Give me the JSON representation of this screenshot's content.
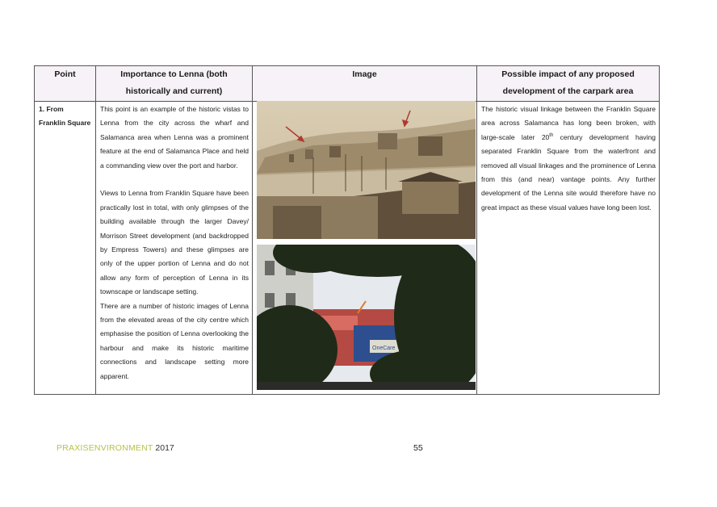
{
  "table": {
    "headers": {
      "point": "Point",
      "importance_line1": "Importance to Lenna (both",
      "importance_line2": "historically and current)",
      "image": "Image",
      "impact_line1": "Possible impact of any proposed",
      "impact_line2": "development of the carpark area"
    },
    "row": {
      "point_line1": "1. From",
      "point_line2": "Franklin Square",
      "importance_p1": "This point is an example of the historic vistas to Lenna from the city across the wharf and Salamanca area when Lenna was a prominent feature at the end of Salamanca Place and held a commanding view over the port and harbor.",
      "importance_p2": "Views to Lenna from Franklin Square have been practically lost in total, with only glimpses of the building available through the larger Davey/ Morrison Street development (and backdropped by Empress Towers) and these glimpses are only of the upper portion of Lenna and do not allow any form of perception of Lenna in its townscape or landscape setting.",
      "importance_p3": "There are a number of historic images of Lenna from the elevated areas of the city centre which emphasise the position of Lenna overlooking the harbour and make its historic maritime connections and landscape setting more apparent.",
      "impact_before_sup": "The historic visual linkage between the Franklin Square area across Salamanca has long been broken, with large-scale later 20",
      "impact_sup": "th",
      "impact_after_sup": " century development having separated Franklin Square from the waterfront and removed all visual linkages and the prominence of Lenna from this (and near) vantage points.  Any further development of the Lenna site would therefore have no great impact as these visual values have long been lost."
    },
    "images": {
      "historic_photo_icon": "historic-sepia-harbour-photo",
      "modern_photo_icon": "modern-view-through-trees-photo",
      "modern_sign_text": "OneCare"
    }
  },
  "footer": {
    "brand": "PRAXISENVIRONMENT",
    "year": " 2017",
    "page_number": "55"
  },
  "colors": {
    "header_bg": "#f7f2f7",
    "border": "#555555",
    "brand": "#b8c14a"
  }
}
